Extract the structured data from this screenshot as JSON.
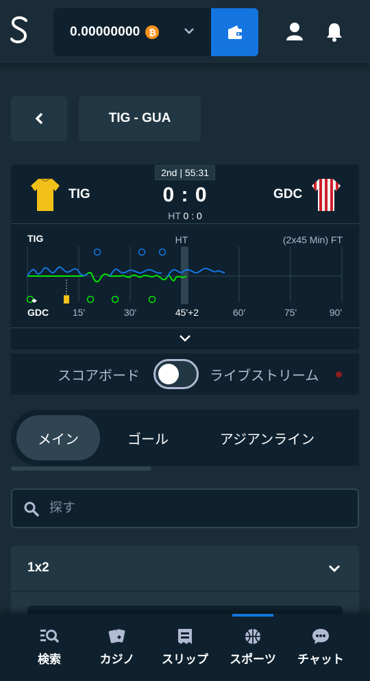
{
  "header": {
    "balance": "0.00000000",
    "currency_symbol": "₿"
  },
  "match": {
    "title": "TIG - GUA",
    "period": "2nd | 55:31",
    "home_team": "TIG",
    "away_team": "GDC",
    "score": "0 : 0",
    "ht_label": "HT",
    "ht_score": "0 : 0"
  },
  "timeline": {
    "home_label": "TIG",
    "away_label": "GDC",
    "ht_label": "HT",
    "format_label": "(2x45 Min) FT",
    "ticks": [
      "15'",
      "30'",
      "45'+2",
      "60'",
      "75'",
      "90'"
    ]
  },
  "toggle": {
    "left_label": "スコアボード",
    "right_label": "ライブストリーム",
    "state": "off"
  },
  "tabs": [
    "メイン",
    "ゴール",
    "アジアンライン"
  ],
  "search": {
    "placeholder": "探す"
  },
  "market": {
    "title": "1x2"
  },
  "bottom_nav": [
    {
      "label": "検索",
      "icon": "search-list-icon"
    },
    {
      "label": "カジノ",
      "icon": "cards-icon"
    },
    {
      "label": "スリップ",
      "icon": "betslip-icon"
    },
    {
      "label": "スポーツ",
      "icon": "basketball-icon"
    },
    {
      "label": "チャット",
      "icon": "chat-icon"
    }
  ],
  "colors": {
    "background": "#1a2c38",
    "panel": "#0f212e",
    "accent": "#1475e1",
    "home_line": "#1475e1",
    "away_line": "#00e701"
  }
}
